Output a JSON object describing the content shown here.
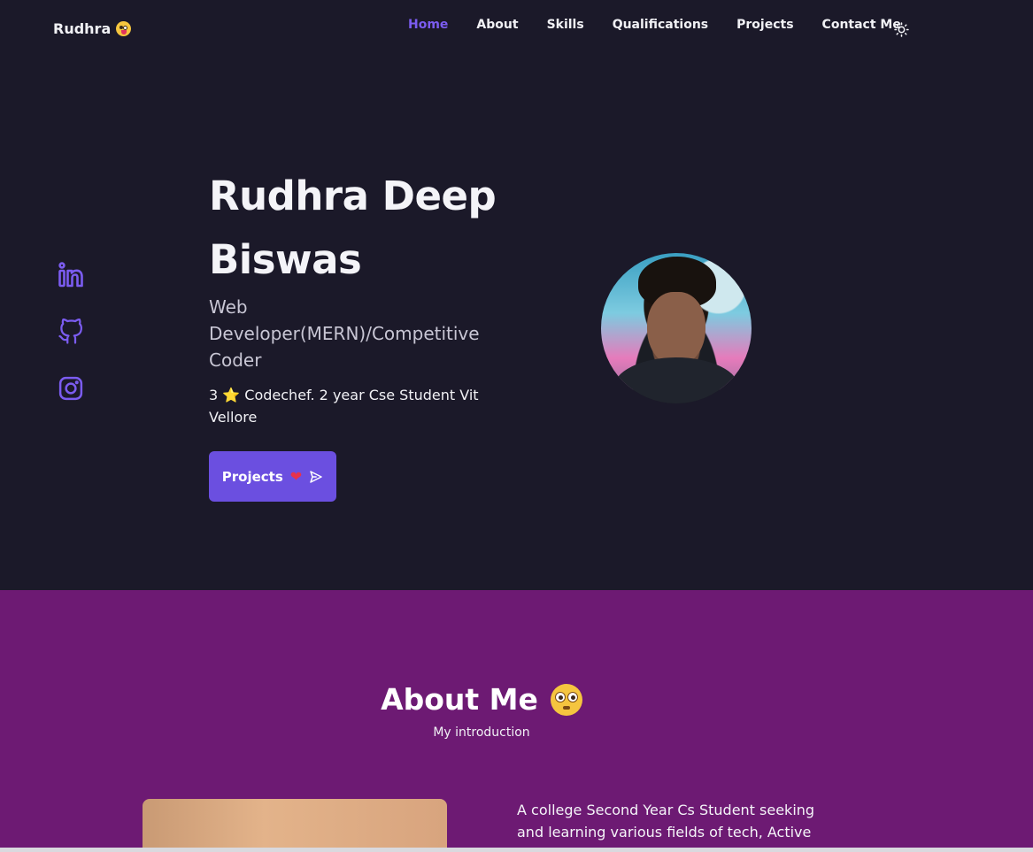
{
  "nav": {
    "brand": "Rudhra",
    "brand_emoji": "zany-face-emoji",
    "links": [
      {
        "label": "Home",
        "active": true
      },
      {
        "label": "About",
        "active": false
      },
      {
        "label": "Skills",
        "active": false
      },
      {
        "label": "Qualifications",
        "active": false
      },
      {
        "label": "Projects",
        "active": false
      },
      {
        "label": "Contact Me",
        "active": false
      }
    ],
    "theme_icon": "sun-icon"
  },
  "socials": [
    {
      "icon": "linkedin-icon"
    },
    {
      "icon": "github-icon"
    },
    {
      "icon": "instagram-icon"
    }
  ],
  "hero": {
    "name_line1": "Rudhra Deep",
    "name_line2": "Biswas",
    "role": "Web Developer(MERN)/Competitive Coder",
    "desc_prefix": "3",
    "desc_star": "⭐",
    "desc_rest": "Codechef. 2 year Cse Student Vit Vellore",
    "button_label": "Projects",
    "button_heart": "❤",
    "button_icon": "send-icon"
  },
  "about": {
    "title": "About Me",
    "title_emoji": "flushed-face-emoji",
    "subtitle": "My introduction",
    "text": "A college Second Year Cs Student seeking and learning various fields of tech, Active"
  },
  "colors": {
    "background": "#1b1929",
    "accent": "#6b4fe0",
    "about_bg": "#6d1a73"
  }
}
